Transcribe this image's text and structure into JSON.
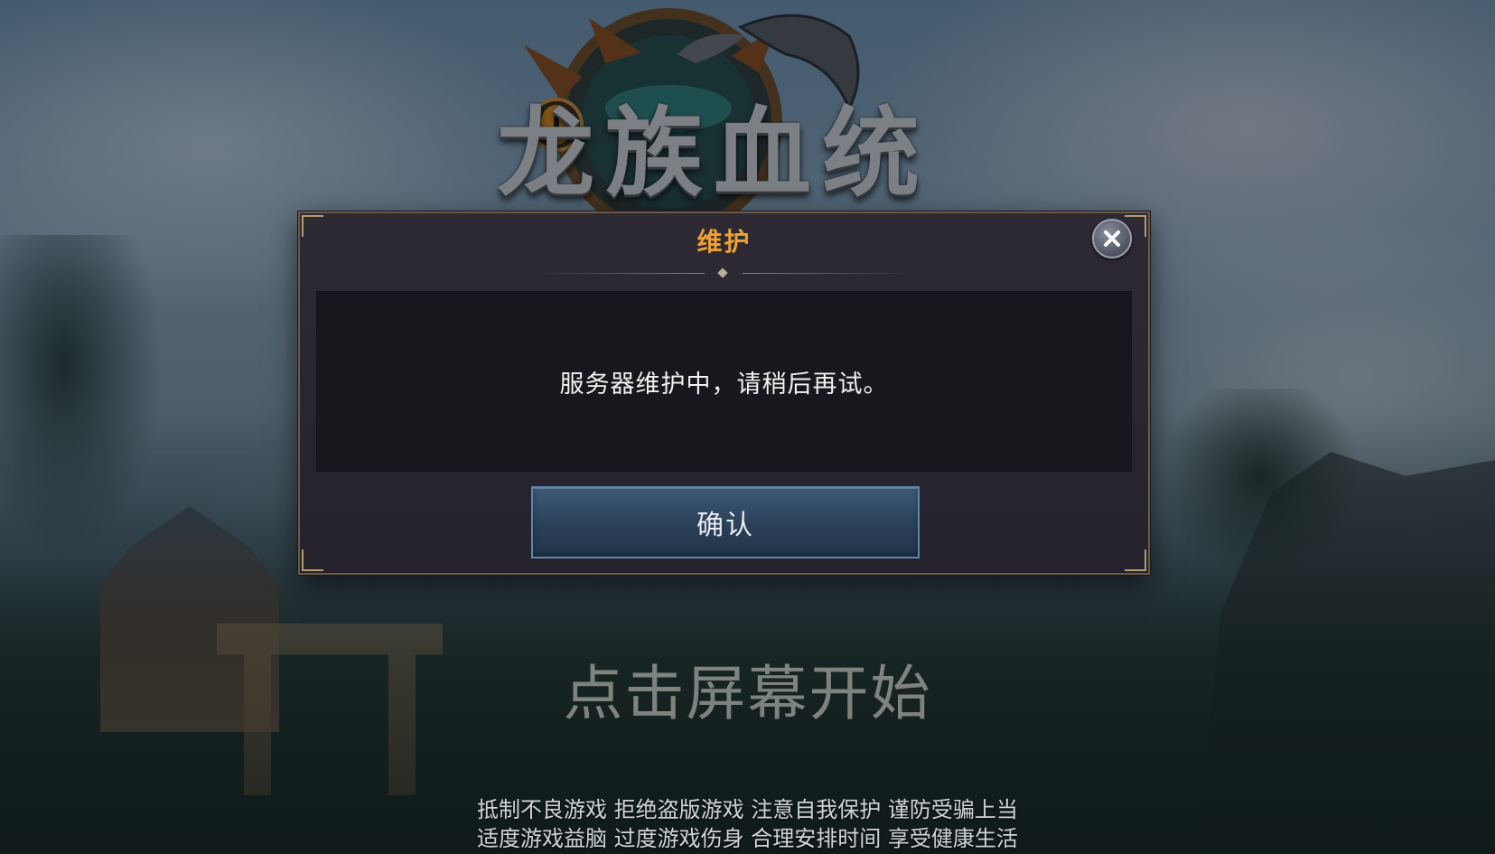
{
  "logo": {
    "text": "龙族血统"
  },
  "dialog": {
    "title": "维护",
    "message": "服务器维护中，请稍后再试。",
    "confirm_label": "确认",
    "close_icon": "close-icon"
  },
  "start_hint": "点击屏幕开始",
  "health_notice": {
    "line1": "抵制不良游戏 拒绝盗版游戏 注意自我保护 谨防受骗上当",
    "line2": "适度游戏益脑 过度游戏伤身 合理安排时间 享受健康生活"
  },
  "colors": {
    "title_accent": "#f0a032",
    "confirm_button": "#2a4058",
    "dialog_background": "#25222b"
  }
}
